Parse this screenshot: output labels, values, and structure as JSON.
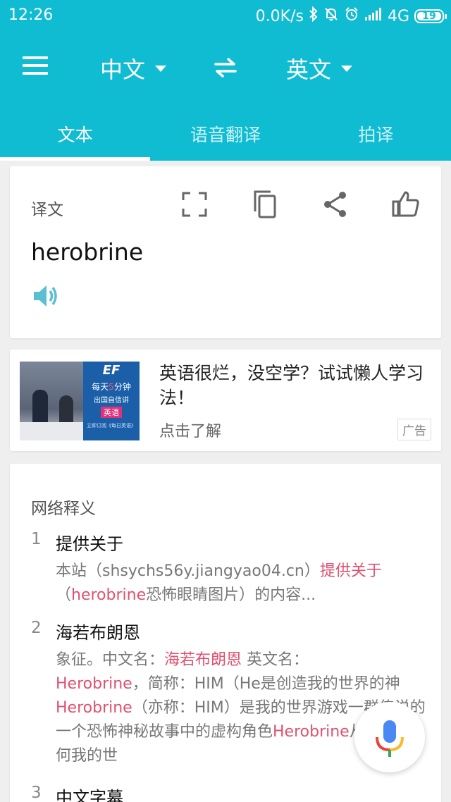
{
  "status": {
    "time": "12:26",
    "net_speed": "0.0K/s",
    "network": "4G",
    "battery": "19"
  },
  "appbar": {
    "source_lang": "中文",
    "target_lang": "英文"
  },
  "tabs": [
    {
      "label": "文本",
      "active": true
    },
    {
      "label": "语音翻译",
      "active": false
    },
    {
      "label": "拍译",
      "active": false
    }
  ],
  "translation": {
    "label": "译文",
    "result": "herobrine"
  },
  "ad": {
    "title": "英语很烂，没空学？试试懒人学习法！",
    "cta": "点击了解",
    "badge": "广告",
    "image_text": {
      "brand": "EF",
      "line1_a": "每天",
      "line1_hl": "5",
      "line1_b": "分钟",
      "line2": "出国自信讲",
      "tag": "英语",
      "small": "立即订阅《每日英语》"
    }
  },
  "web_definitions": {
    "section_title": "网络释义",
    "entries": [
      {
        "num": "1",
        "head": "提供关于",
        "body": [
          {
            "t": "本站（shsychs56y.jiangyao04.cn）",
            "hl": false
          },
          {
            "t": "提供关于",
            "hl": true
          },
          {
            "t": "（",
            "hl": false
          },
          {
            "t": "herobrine",
            "hl": true
          },
          {
            "t": "恐怖眼睛图片）的内容...",
            "hl": false
          }
        ]
      },
      {
        "num": "2",
        "head": "海若布朗恩",
        "body": [
          {
            "t": "象征。中文名：",
            "hl": false
          },
          {
            "t": "海若布朗恩",
            "hl": true
          },
          {
            "t": " 英文名：",
            "hl": false
          },
          {
            "t": "Herobrine",
            "hl": true
          },
          {
            "t": "，简称：HIM（He是创造我的世界的神",
            "hl": false
          },
          {
            "t": "Herobrine",
            "hl": true
          },
          {
            "t": "（亦称：HIM）是我的世界游戏一群传说的一个恐怖神秘故事中的虚构角色",
            "hl": false
          },
          {
            "t": "Herobrine",
            "hl": true
          },
          {
            "t": "从未在任何我的世",
            "hl": false
          }
        ]
      },
      {
        "num": "3",
        "head": "中文字幕",
        "body": []
      }
    ]
  },
  "colors": {
    "primary": "#0fbcd2",
    "highlight": "#e0516f"
  }
}
